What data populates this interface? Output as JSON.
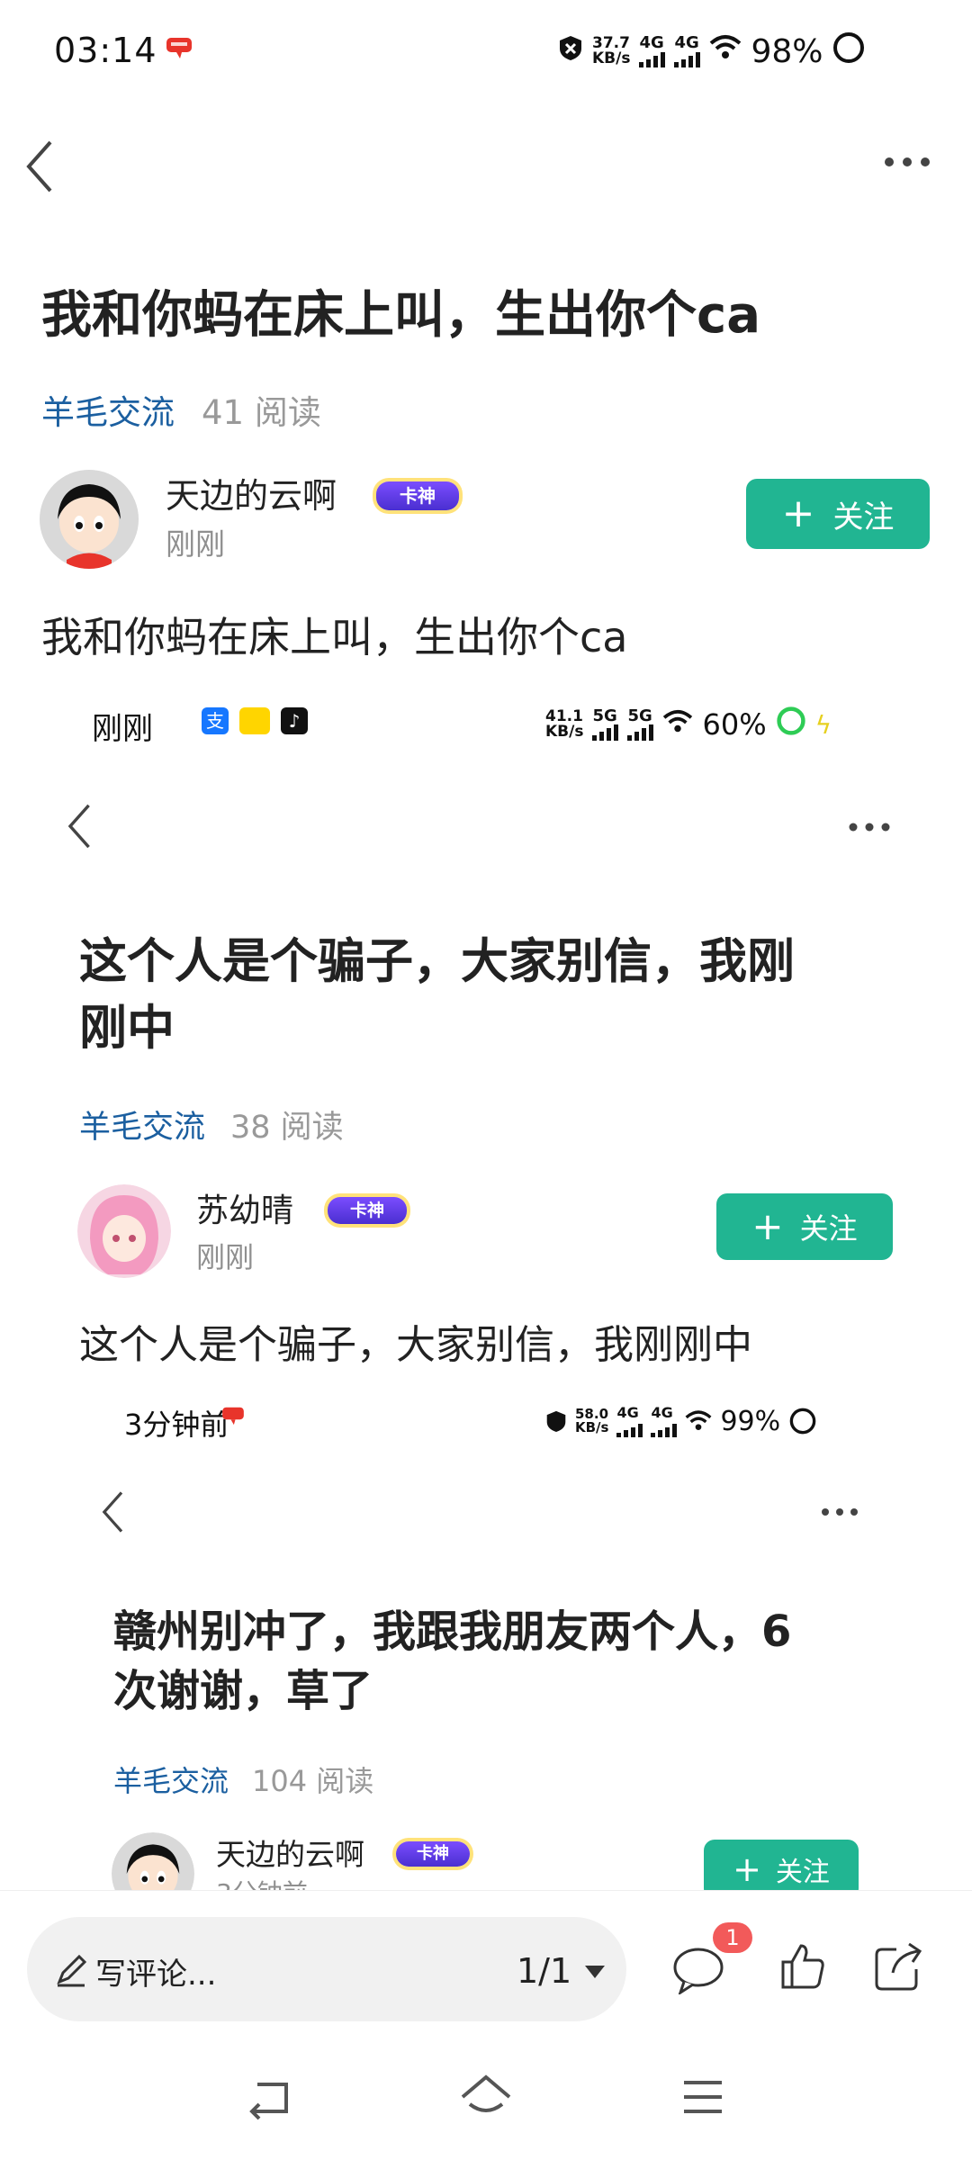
{
  "status": {
    "time": "03:14",
    "net_speed": "37.7",
    "net_unit": "KB/s",
    "net1": "4G",
    "net2": "4G",
    "battery": "98%"
  },
  "post": {
    "title": "我和你蚂在床上叫，生出你个ca",
    "category": "羊毛交流",
    "reads": "41 阅读",
    "author": "天边的云啊",
    "badge": "卡神",
    "time": "刚刚",
    "follow": "关注",
    "body": "我和你蚂在床上叫，生出你个ca"
  },
  "shot1": {
    "time": "刚刚",
    "net_speed": "41.1",
    "net_unit": "KB/s",
    "net1": "5G",
    "net2": "5G",
    "battery": "60%",
    "title_line1": "这个人是个骗子，大家别信，我刚",
    "title_line2": "刚中",
    "category": "羊毛交流",
    "reads": "38 阅读",
    "author": "苏幼晴",
    "badge": "卡神",
    "follow": "关注",
    "body": "这个人是个骗子，大家别信，我刚刚中"
  },
  "shot2": {
    "time": "3分钟前",
    "net_speed": "58.0",
    "net_unit": "KB/s",
    "net1": "4G",
    "net2": "4G",
    "battery": "99%",
    "title_line1": "赣州别冲了，我跟我朋友两个人，6",
    "title_line2": "次谢谢，草了",
    "category": "羊毛交流",
    "reads": "104 阅读",
    "author": "天边的云啊",
    "badge": "卡神",
    "follow": "关注"
  },
  "bottom": {
    "comment_placeholder": "写评论...",
    "page": "1/1",
    "comment_count": "1"
  },
  "colors": {
    "accent": "#21b592",
    "category": "#1b5fa0",
    "badge_notify": "#f25a5a"
  }
}
